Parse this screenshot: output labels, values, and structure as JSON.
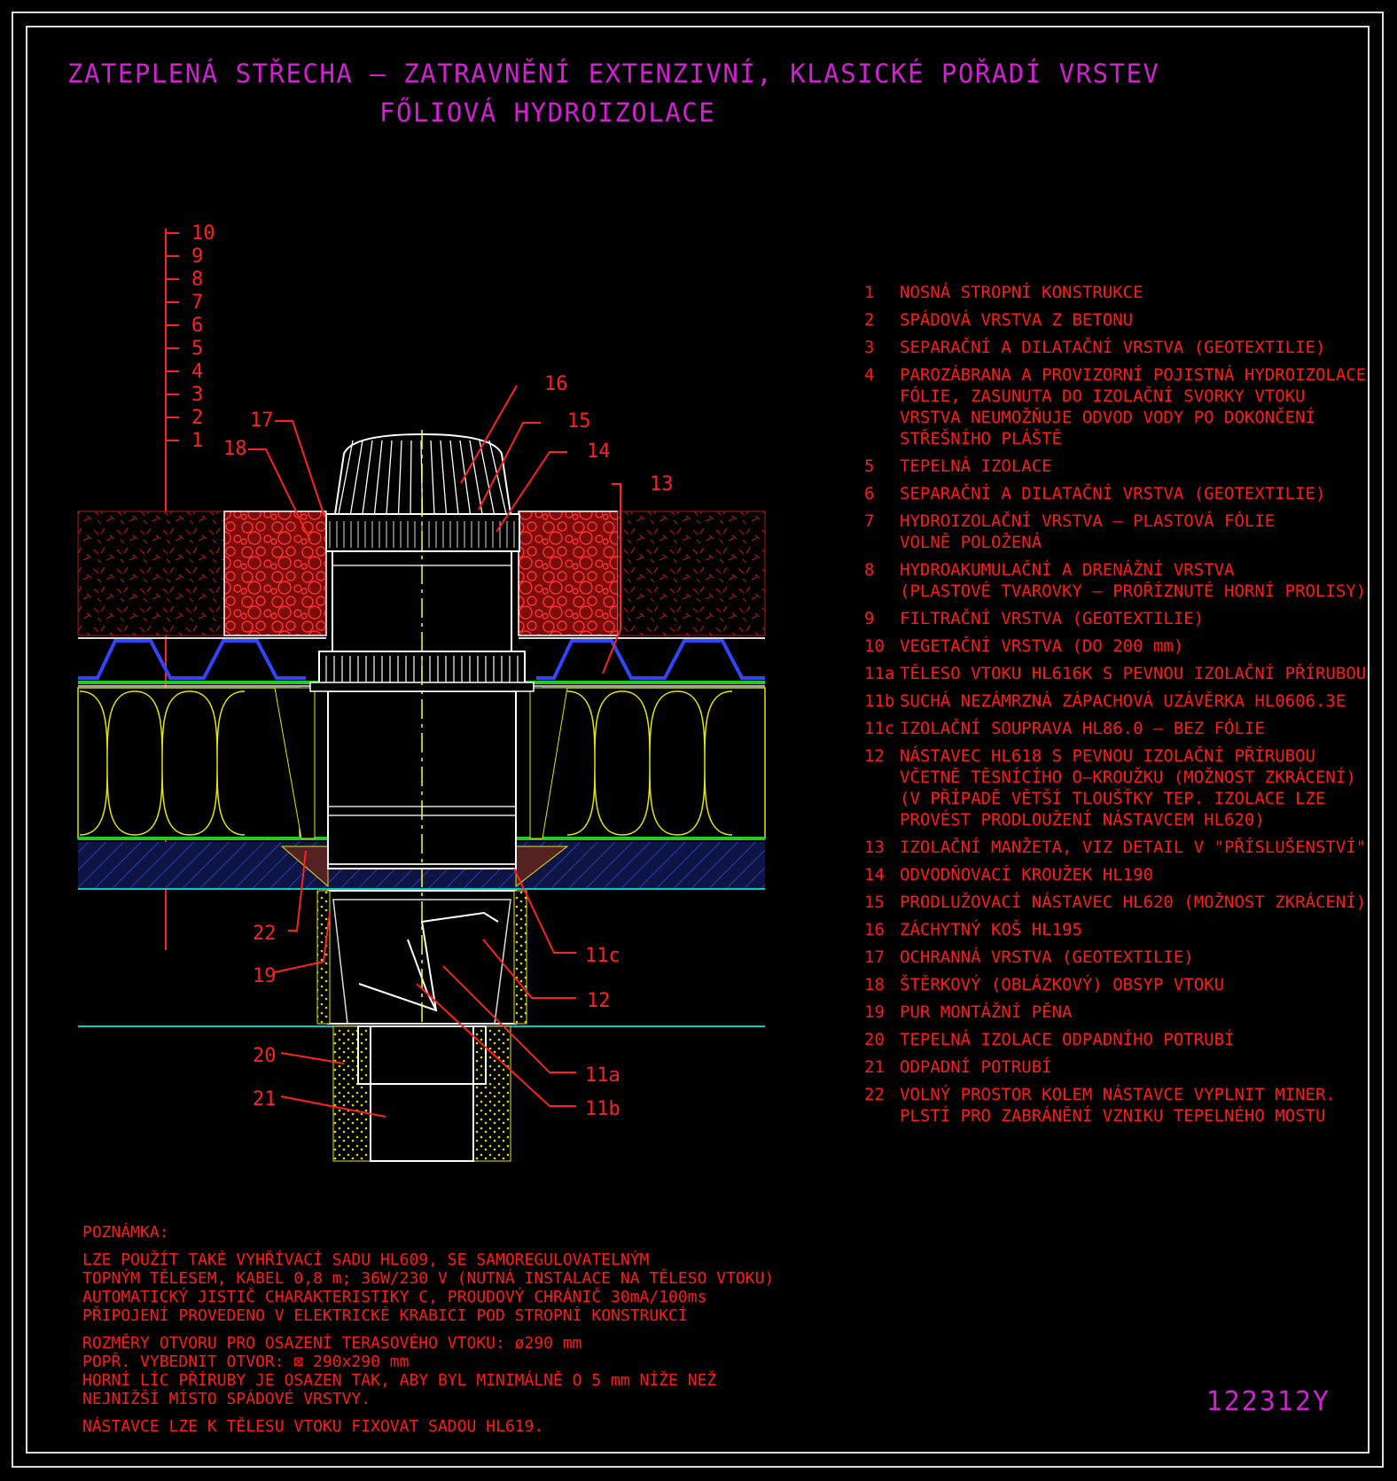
{
  "title": {
    "line1": "ZATEPLENÁ STŘECHA – ZATRAVNĚNÍ EXTENZIVNÍ, KLASICKÉ POŘADÍ VRSTEV",
    "line2": "FŐLIOVÁ HYDROIZOLACE"
  },
  "scale_labels": [
    "10",
    "9",
    "8",
    "7",
    "6",
    "5",
    "4",
    "3",
    "2",
    "1"
  ],
  "callouts": {
    "c16": "16",
    "c15": "15",
    "c14": "14",
    "c13": "13",
    "c17": "17",
    "c18": "18",
    "c22": "22",
    "c19": "19",
    "c20": "20",
    "c21": "21",
    "c11c": "11c",
    "c12": "12",
    "c11a": "11a",
    "c11b": "11b"
  },
  "legend": [
    {
      "num": "1",
      "text": "NOSNÁ STROPNÍ KONSTRUKCE"
    },
    {
      "num": "2",
      "text": "SPÁDOVÁ VRSTVA Z BETONU"
    },
    {
      "num": "3",
      "text": "SEPARAČNÍ A DILATAČNÍ VRSTVA (GEOTEXTILIE)"
    },
    {
      "num": "4",
      "text": "PAROZÁBRANA A PROVIZORNÍ POJISTNÁ HYDROIZOLACE\nFÓLIE, ZASUNUTA DO IZOLAČNÍ SVORKY VTOKU\nVRSTVA NEUMOŽŇUJE ODVOD VODY PO DOKONČENÍ\nSTŘEŠNÍHO PLÁŠTĚ"
    },
    {
      "num": "5",
      "text": "TEPELNÁ IZOLACE"
    },
    {
      "num": "6",
      "text": "SEPARAČNÍ A DILATAČNÍ VRSTVA (GEOTEXTILIE)"
    },
    {
      "num": "7",
      "text": "HYDROIZOLAČNÍ VRSTVA – PLASTOVÁ FÓLIE\nVOLNĚ POLOŽENÁ"
    },
    {
      "num": "8",
      "text": "HYDROAKUMULAČNÍ A DRENÁŽNÍ VRSTVA\n(PLASTOVÉ TVAROVKY – PROŘÍZNUTÉ HORNÍ PROLISY)"
    },
    {
      "num": "9",
      "text": "FILTRAČNÍ VRSTVA (GEOTEXTILIE)"
    },
    {
      "num": "10",
      "text": "VEGETAČNÍ VRSTVA (DO 200 mm)"
    },
    {
      "num": "11a",
      "text": "TĚLESO VTOKU HL616K S PEVNOU IZOLAČNÍ PŘÍRUBOU"
    },
    {
      "num": "11b",
      "text": "SUCHÁ NEZÁMRZNÁ ZÁPACHOVÁ UZÁVĚRKA HL0606.3E"
    },
    {
      "num": "11c",
      "text": "IZOLAČNÍ SOUPRAVA HL86.0 – BEZ FÓLIE"
    },
    {
      "num": "12",
      "text": "NÁSTAVEC HL618 S PEVNOU IZOLAČNÍ PŘÍRUBOU\nVČETNĚ TĚSNÍCÍHO O–KROUŽKU (MOŽNOST ZKRÁCENÍ)\n(V PŘÍPADĚ VĚTŠÍ TLOUŠŤKY TEP. IZOLACE LZE\nPROVÉST PRODLOUŽENÍ NÁSTAVCEM HL620)"
    },
    {
      "num": "13",
      "text": "IZOLAČNÍ MANŽETA, VIZ DETAIL V \"PŘÍSLUŠENSTVÍ\""
    },
    {
      "num": "14",
      "text": "ODVODŇOVACÍ KROUŽEK HL190"
    },
    {
      "num": "15",
      "text": "PRODLUŽOVACÍ NÁSTAVEC HL620 (MOŽNOST ZKRÁCENÍ)"
    },
    {
      "num": "16",
      "text": "ZÁCHYTNÝ KOŠ HL195"
    },
    {
      "num": "17",
      "text": "OCHRANNÁ VRSTVA (GEOTEXTILIE)"
    },
    {
      "num": "18",
      "text": "ŠTĚRKOVÝ (OBLÁZKOVÝ) OBSYP VTOKU"
    },
    {
      "num": "19",
      "text": "PUR MONTÁŽNÍ PĚNA"
    },
    {
      "num": "20",
      "text": "TEPELNÁ IZOLACE ODPADNÍHO POTRUBÍ"
    },
    {
      "num": "21",
      "text": "ODPADNÍ POTRUBÍ"
    },
    {
      "num": "22",
      "text": "VOLNÝ PROSTOR KOLEM NÁSTAVCE VYPLNIT MINER.\nPLSTÍ PRO ZABRÁNĚNÍ VZNIKU TEPELNÉHO MOSTU"
    }
  ],
  "notes": [
    "POZNÁMKA:",
    "LZE POUŽÍT TAKÉ VYHŘÍVACÍ SADU HL609, SE SAMOREGULOVATELNÝM\nTOPNÝM TĚLESEM, KABEL 0,8 m; 36W/230 V (NUTNÁ INSTALACE NA TĚLESO VTOKU)\nAUTOMATICKÝ JISTIČ CHARAKTERISTIKY C, PROUDOVÝ CHRÁNIČ 30mA/100ms\nPŘIPOJENÍ PROVEDENO V ELEKTRICKÉ KRABICI POD STROPNÍ KONSTRUKCÍ",
    "ROZMĚRY OTVORU PRO OSAZENÍ TERASOVÉHO VTOKU: ø290 mm\nPOPŘ. VYBEDNIT OTVOR: ⊠ 290x290 mm\nHORNÍ LÍC PŘÍRUBY JE OSAZEN TAK, ABY BYL MINIMÁLNĚ O 5 mm NÍŽE NEŽ\nNEJNIŽŠÍ MÍSTO SPÁDOVÉ VRSTVY.",
    "NÁSTAVCE LZE K TĚLESU VTOKU FIXOVAT SADOU HL619."
  ],
  "drawing_code": "122312Y",
  "colors": {
    "background": "#000000",
    "title": "#d11fd1",
    "text": "#ff1a1a",
    "frame": "#dddddd",
    "gravel": "#b01010",
    "insulation": "#e6e600",
    "membrane": "#2a2aff",
    "concrete": "#1e2a8a",
    "pipe": "#ffffff",
    "axis": "#ffff33",
    "cyan": "#00cccc",
    "green": "#22cc22"
  }
}
